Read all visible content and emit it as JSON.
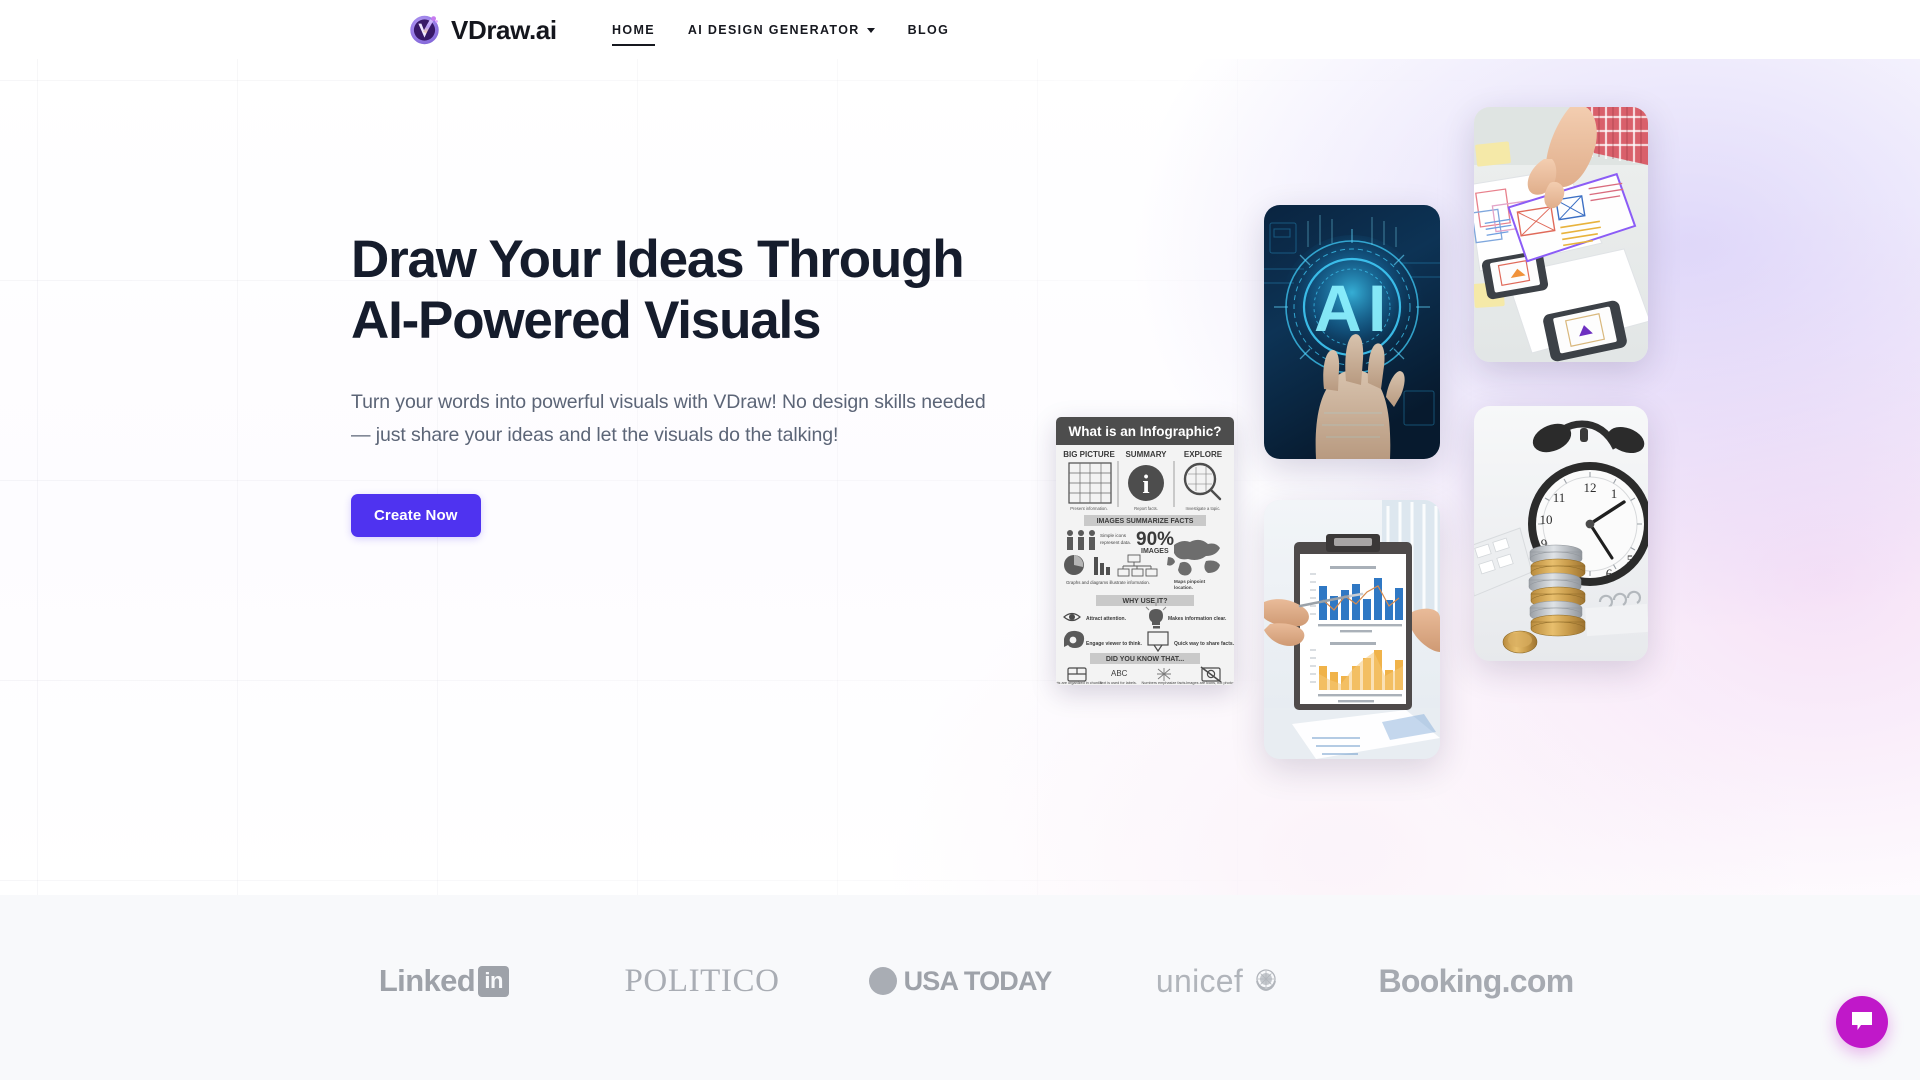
{
  "site": {
    "brand_name": "VDraw.ai",
    "logo_icon": "vdraw-logo-icon"
  },
  "header": {
    "nav": [
      {
        "label": "HOME",
        "active": true,
        "has_dropdown": false
      },
      {
        "label": "AI DESIGN GENERATOR",
        "active": false,
        "has_dropdown": true
      },
      {
        "label": "BLOG",
        "active": false,
        "has_dropdown": false
      }
    ]
  },
  "hero": {
    "title_line1": "Draw Your Ideas Through",
    "title_line2": "AI-Powered Visuals",
    "subtitle": "Turn your words into powerful visuals with VDraw! No design skills needed — just share your ideas and let the visuals do the talking!",
    "cta_label": "Create Now",
    "cta_color": "#4f33f0",
    "images": [
      {
        "name": "ai-hologram-hand-image",
        "alt": "Hand holding glowing AI hologram"
      },
      {
        "name": "ux-wireframe-sketches-image",
        "alt": "Hand arranging paper UX wireframe sketches"
      },
      {
        "name": "bar-chart-clipboard-image",
        "alt": "Hands holding clipboard with bar charts"
      },
      {
        "name": "alarm-clock-coins-image",
        "alt": "Alarm clock behind a stack of coins"
      }
    ]
  },
  "infographic": {
    "title": "What is an Infographic?",
    "columns": [
      {
        "heading": "BIG PICTURE",
        "icon": "puzzle-grid-icon",
        "caption": "Present information."
      },
      {
        "heading": "SUMMARY",
        "icon": "info-circle-icon",
        "caption": "Report facts."
      },
      {
        "heading": "EXPLORE",
        "icon": "magnifier-puzzle-icon",
        "caption": "Investigate a topic."
      }
    ],
    "band_1": "IMAGES SUMMARIZE FACTS",
    "stats": {
      "people_caption": "Simple icons represent data.",
      "big_number": "90%",
      "big_number_label": "IMAGES",
      "charts_caption": "Graphs and diagrams illustrate information.",
      "map_caption": "Maps pinpoint location."
    },
    "band_2": "WHY USE IT?",
    "reasons": [
      {
        "icon": "eye-icon",
        "text": "Attract attention."
      },
      {
        "icon": "lightbulb-icon",
        "text": "Makes information clear."
      },
      {
        "icon": "brain-gear-icon",
        "text": "Engage viewer to think."
      },
      {
        "icon": "share-icon",
        "text": "Quick way to share facts."
      }
    ],
    "band_3": "DID YOU KNOW THAT...",
    "facts": [
      {
        "icon": "chunks-icon",
        "text": "Facts are organized in chunks."
      },
      {
        "icon": "abc-icon",
        "label": "ABC",
        "text": "Text is used for labels or short descriptions."
      },
      {
        "icon": "hash-icon",
        "text": "Numbers emphasize important facts."
      },
      {
        "icon": "no-photo-icon",
        "text": "Images are icons, not photos."
      }
    ]
  },
  "logos": {
    "items": [
      {
        "name": "linkedin-logo",
        "text": "Linked",
        "badge": "in"
      },
      {
        "name": "politico-logo",
        "text": "POLITICO"
      },
      {
        "name": "usatoday-logo",
        "text": "USA TODAY"
      },
      {
        "name": "unicef-logo",
        "text": "unicef"
      },
      {
        "name": "booking-logo",
        "text": "Booking.com"
      }
    ]
  },
  "chat": {
    "icon": "chat-bubble-icon",
    "color": "#c018c9"
  }
}
